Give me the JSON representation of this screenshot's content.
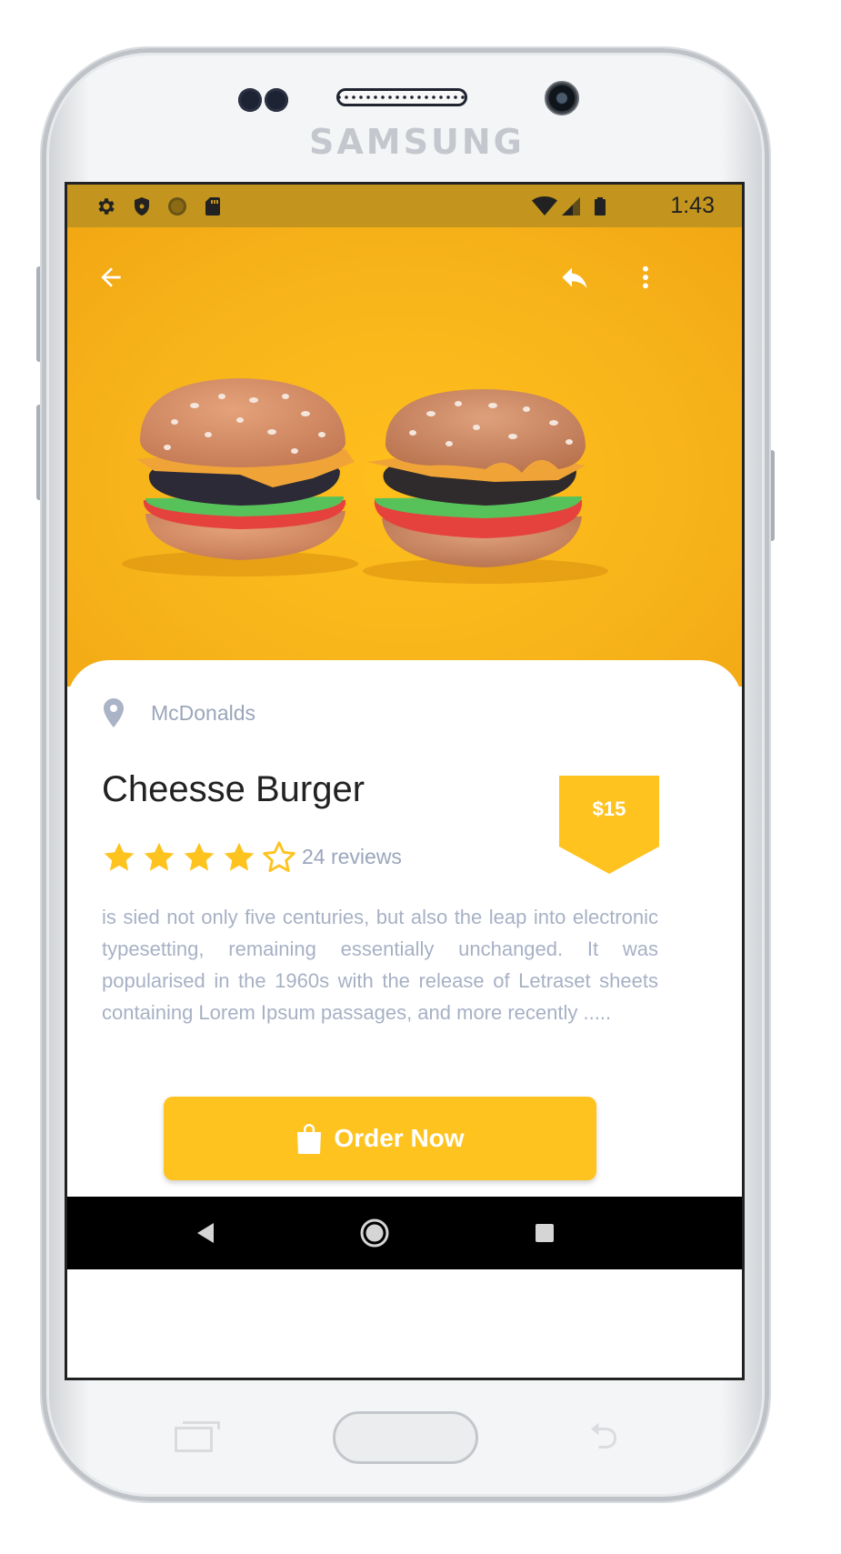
{
  "device": {
    "brand": "SAMSUNG"
  },
  "status_bar": {
    "time": "1:43",
    "icons_left": [
      "settings-icon",
      "shield-icon",
      "circle-icon",
      "sd-card-icon"
    ],
    "icons_right": [
      "wifi-icon",
      "signal-icon",
      "battery-icon"
    ]
  },
  "toolbar": {
    "icons": [
      "back-arrow-icon",
      "share-icon",
      "more-vert-icon"
    ]
  },
  "product": {
    "restaurant": "McDonalds",
    "name": "Cheesse Burger",
    "price": "$15",
    "rating": 4,
    "rating_max": 5,
    "reviews": "24 reviews",
    "description": "is sied not only five centuries, but also the leap into electronic typesetting, remaining essentially unchanged. It was popularised in the 1960s with the release of Letraset sheets containing Lorem Ipsum passages, and more recently .....",
    "order_label": "Order Now"
  },
  "colors": {
    "accent": "#fec31f",
    "status_bar": "#c3951e",
    "muted_text": "#9aa6bb",
    "title_text": "#222222"
  },
  "nav_bar": {
    "icons": [
      "nav-back-icon",
      "nav-home-icon",
      "nav-recents-icon"
    ]
  }
}
